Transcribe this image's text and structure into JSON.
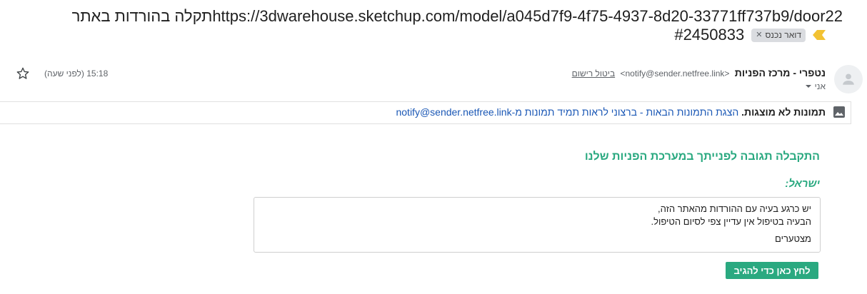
{
  "subject": {
    "line1": "https://3dwarehouse.sketchup.com/model/a045d7f9-4f75-4937-8d20-33771ff737b9/door22תקלה בהורדות באתר",
    "id": "#2450833",
    "label": "דואר נכנס"
  },
  "header": {
    "sender_name": "נטפרי - מרכז הפניות",
    "sender_email": "<notify@sender.netfree.link>",
    "unsubscribe": "ביטול רישום",
    "to": "אני",
    "time": "15:18 (לפני שעה)"
  },
  "images_banner": {
    "bold": "תמונות לא מוצגות.",
    "show_link": "הצגת התמונות הבאות",
    "separator": " - ",
    "always_link": "ברצוני לראות תמיד תמונות מ-notify@sender.netfree.link"
  },
  "body": {
    "title": "התקבלה תגובה לפנייתך במערכת הפניות שלנו",
    "greeting": "ישראל:",
    "message_line1": "יש כרגע בעיה עם ההורדות מהאתר הזה,",
    "message_line2": "הבעיה בטיפול אין עדיין צפי לסיום הטיפול.",
    "signature": "מצטערים",
    "reply_button": "לחץ כאן כדי להגיב"
  },
  "colors": {
    "accent": "#2aa980",
    "link": "#1a57b5",
    "importance": "#f2c233"
  },
  "icons": {
    "importance": "importance-marker-icon",
    "star": "star-icon",
    "avatar": "person-icon",
    "image": "image-icon",
    "dropdown": "caret-down-icon"
  }
}
